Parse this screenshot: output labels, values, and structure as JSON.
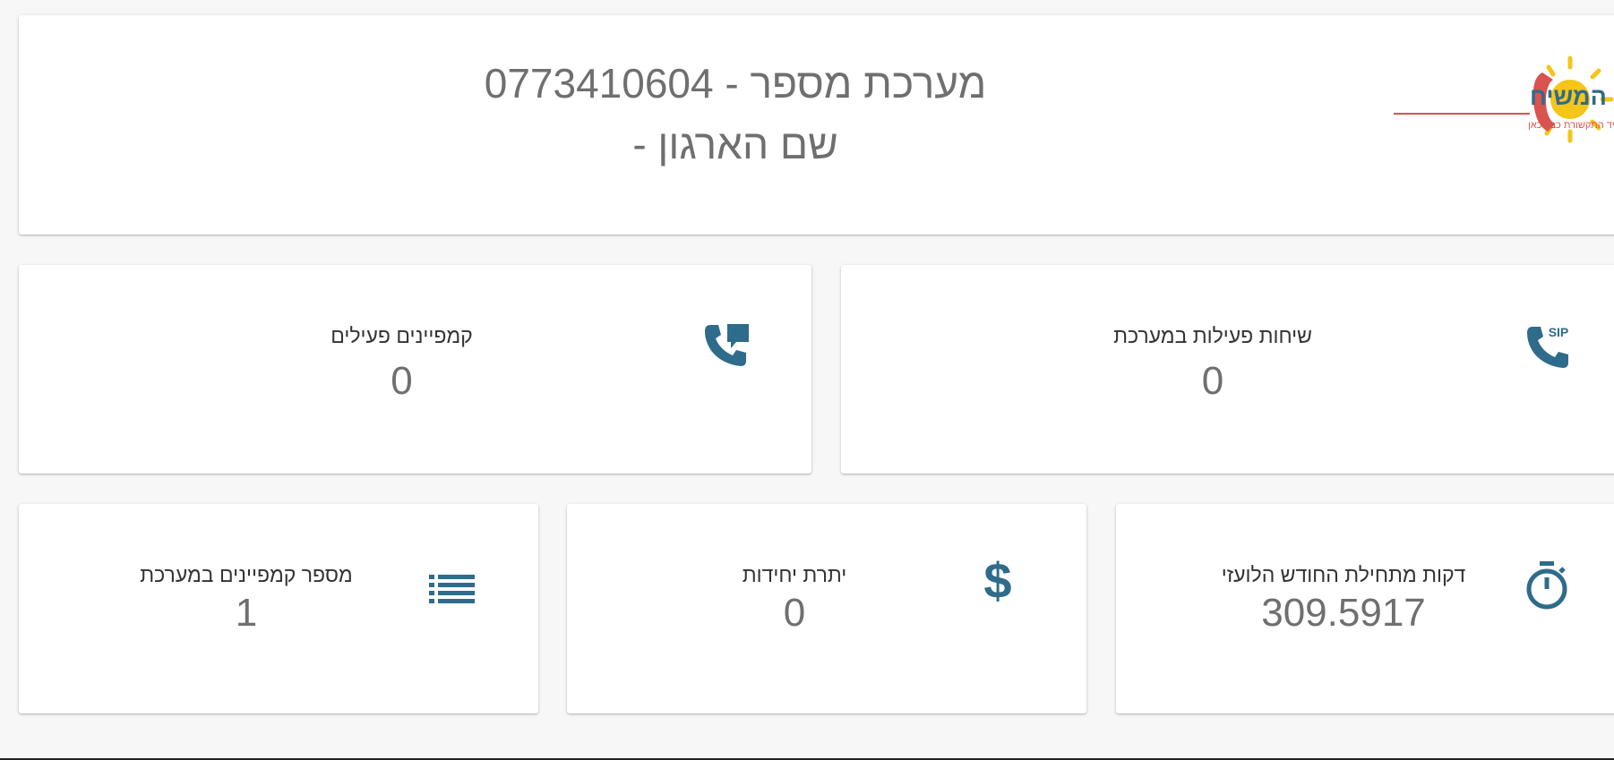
{
  "header": {
    "title_line1": "מערכת מספר - 0773410604",
    "title_line2": "שם הארגון -",
    "logo": {
      "text": "ימות המשיח",
      "tagline": "עתיד התקשורת כבר כאן",
      "icon": "sun-phone-logo-icon"
    }
  },
  "stats": {
    "active_campaigns": {
      "label": "קמפיינים פעילים",
      "value": "0",
      "icon": "phone-chat-icon"
    },
    "active_calls": {
      "label": "שיחות פעילות במערכת",
      "value": "0",
      "icon": "sip-phone-icon"
    },
    "campaign_count": {
      "label": "מספר קמפיינים במערכת",
      "value": "1",
      "icon": "list-icon"
    },
    "units_balance": {
      "label": "יתרת יחידות",
      "value": "0",
      "icon": "dollar-icon"
    },
    "minutes_month": {
      "label": "דקות מתחילת החודש הלועזי",
      "value": "309.5917",
      "icon": "stopwatch-icon"
    }
  },
  "colors": {
    "icon": "#2f6b8a",
    "title": "#6f6f6f",
    "background": "#f7f7f7",
    "logo_red": "#d9534f",
    "logo_yellow": "#f5c518"
  }
}
